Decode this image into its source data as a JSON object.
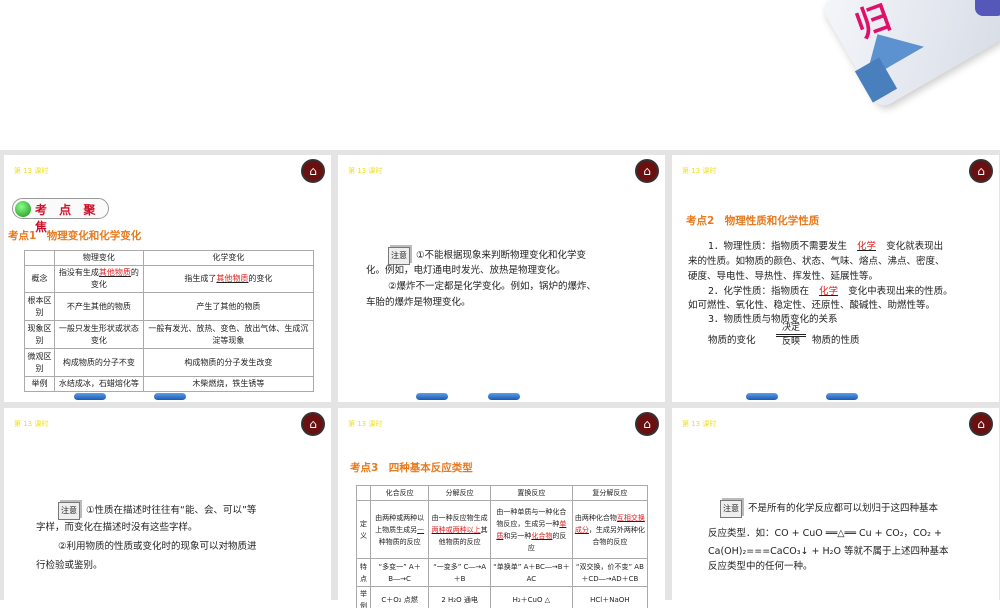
{
  "logo": {
    "char": "归"
  },
  "lesson": "第 13 课时",
  "home_icon": "home-icon",
  "slide1": {
    "banner": "考 点 聚 焦",
    "heading": "考点1　物理变化和化学变化",
    "table": {
      "headers": [
        "",
        "物理变化",
        "化学变化"
      ],
      "rows": [
        {
          "label": "概念",
          "phys_pre": "指没有生成",
          "phys_ans": "其他物质",
          "phys_post": "的变化",
          "chem_pre": "指生成了",
          "chem_ans": "其他物质",
          "chem_post": "的变化"
        },
        {
          "label": "根本区别",
          "phys": "不产生其他的物质",
          "chem": "产生了其他的物质"
        },
        {
          "label": "现象区别",
          "phys": "一般只发生形状或状态变化",
          "chem": "一般有发光、放热、变色、放出气体、生成沉淀等现象"
        },
        {
          "label": "微观区别",
          "phys": "构成物质的分子不变",
          "chem": "构成物质的分子发生改变"
        },
        {
          "label": "举例",
          "phys": "水结成冰，石蜡熔化等",
          "chem": "木柴燃烧，铁生锈等"
        }
      ]
    }
  },
  "slide2": {
    "note": "注意",
    "l1": "①不能根据现象来判断物理变化和化学变",
    "l2": "化。例如，电灯通电时发光、放热是物理变化。",
    "l3": "②爆炸不一定都是化学变化。例如，锅炉的爆炸、",
    "l4": "车胎的爆炸是物理变化。"
  },
  "slide3": {
    "heading": "考点2　物理性质和化学性质",
    "l1a": "1．物理性质：指物质不需要发生",
    "l1ans": "化学",
    "l1b": "变化就表现出",
    "l2": "来的性质。如物质的颜色、状态、气味、熔点、沸点、密度、",
    "l3": "硬度、导电性、导热性、挥发性、延展性等。",
    "l4a": "2．化学性质：指物质在",
    "l4ans": "化学",
    "l4b": "变化中表现出来的性质。",
    "l5": "如可燃性、氧化性、稳定性、还原性、酸碱性、助燃性等。",
    "l6": "3．物质性质与物质变化的关系",
    "rel_left": "物质的变化",
    "rel_top": "决定",
    "rel_bottom": "反映",
    "rel_right": "物质的性质"
  },
  "slide4": {
    "note": "注意",
    "l1": "①性质在描述时往往有“能、会、可以”等",
    "l2": "字样，而变化在描述时没有这些字样。",
    "l3": "②利用物质的性质或变化时的现象可以对物质进",
    "l4": "行检验或鉴别。"
  },
  "slide5": {
    "heading": "考点3　四种基本反应类型",
    "headers": [
      "",
      "化合反应",
      "分解反应",
      "置换反应",
      "复分解反应"
    ],
    "def_label": "定义",
    "def": {
      "c1a": "由两种或两种以上物质生成另",
      "c1ans": "一",
      "c1b": "种物质的反应",
      "c2a": "由一种反应物生成",
      "c2ans": "两种或两种以上",
      "c2b": "其他物质的反应",
      "c3a": "由一种单质与一种化合物反应，生成另一种",
      "c3ans1": "单质",
      "c3b": "和另一种",
      "c3ans2": "化合物",
      "c3c": "的反应",
      "c4a": "由两种化合物",
      "c4ans": "互相交换成分",
      "c4b": "，生成另外两种化合物的反应"
    },
    "feat_label": "特点",
    "feat": [
      "“多变一” A＋B―→C",
      "“一变多” C―→A＋B",
      "“单换单” A＋BC―→B＋AC",
      "“双交换，价不变” AB＋CD―→AD＋CB"
    ],
    "ex_label": "举例",
    "ex": [
      "C＋O₂ 点燃",
      "2 H₂O 通电",
      "H₂＋CuO △",
      "HCl＋NaOH"
    ]
  },
  "slide6": {
    "note": "注意",
    "l1": "不是所有的化学反应都可以划归于这四种基本",
    "l2": "反应类型．如：CO + CuO ══△══ Cu + CO₂，CO₂ +",
    "l3": "Ca(OH)₂===CaCO₃↓ + H₂O  等就不属于上述四种基本",
    "l4": "反应类型中的任何一种。"
  }
}
